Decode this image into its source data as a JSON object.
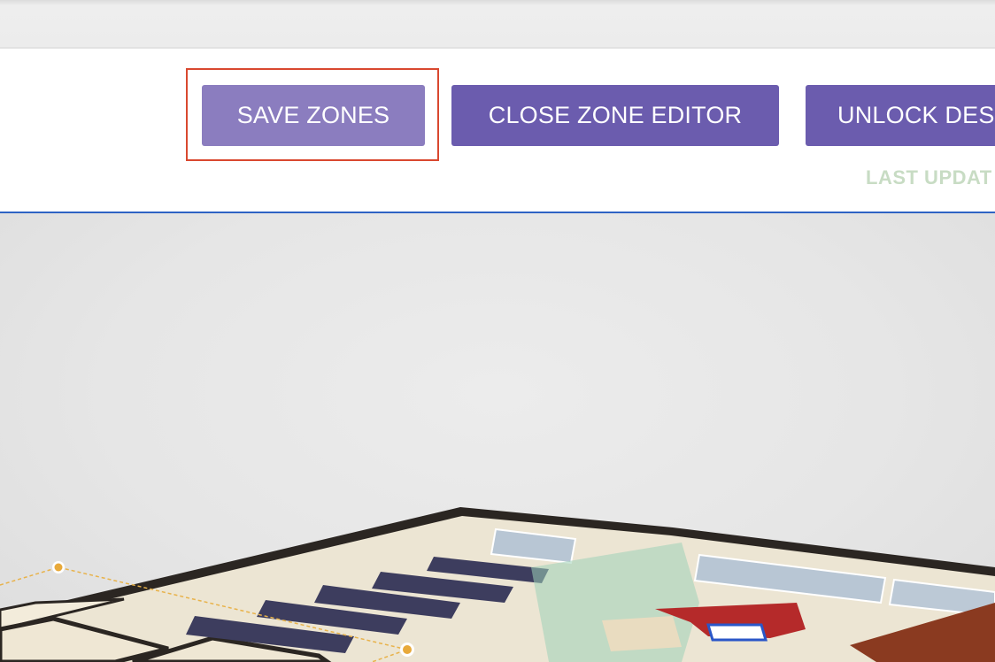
{
  "toolbar": {
    "save_label": "SAVE ZONES",
    "close_label": "CLOSE ZONE EDITOR",
    "unlock_label": "UNLOCK DES",
    "last_updated_label": "LAST UPDAT"
  },
  "colors": {
    "primary_button": "#6b5cae",
    "save_button_light": "#8b7dbf",
    "highlight_outline": "#d9482f",
    "divider": "#2e63c4",
    "zone_handle": "#e8a93a"
  },
  "icons": {
    "zone_handle": "zone-handle-icon"
  }
}
